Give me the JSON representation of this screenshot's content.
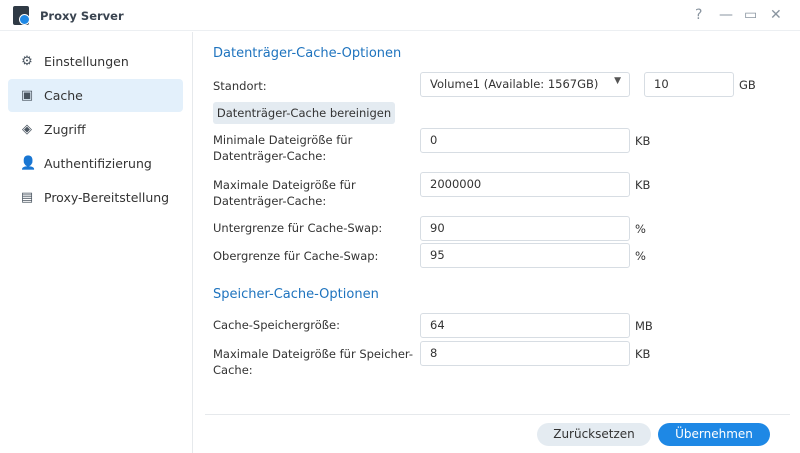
{
  "window": {
    "title": "Proxy Server",
    "help": "?",
    "minimize": "—",
    "maximize": "▭",
    "close": "✕"
  },
  "sidebar": {
    "items": [
      {
        "label": "Einstellungen",
        "icon": "gear-icon"
      },
      {
        "label": "Cache",
        "icon": "cache-icon"
      },
      {
        "label": "Zugriff",
        "icon": "shield-icon"
      },
      {
        "label": "Authentifizierung",
        "icon": "user-icon"
      },
      {
        "label": "Proxy-Bereitstellung",
        "icon": "router-icon"
      }
    ]
  },
  "disk": {
    "title": "Datenträger-Cache-Optionen",
    "location_label": "Standort:",
    "location_value": "Volume1 (Available: 1567GB)",
    "size_value": "10",
    "size_unit": "GB",
    "clear_button": "Datenträger-Cache bereinigen",
    "min_label": "Minimale Dateigröße für Datenträger-Cache:",
    "min_value": "0",
    "min_unit": "KB",
    "max_label": "Maximale Dateigröße für Datenträger-Cache:",
    "max_value": "2000000",
    "max_unit": "KB",
    "low_label": "Untergrenze für Cache-Swap:",
    "low_value": "90",
    "low_unit": "%",
    "high_label": "Obergrenze für Cache-Swap:",
    "high_value": "95",
    "high_unit": "%"
  },
  "memory": {
    "title": "Speicher-Cache-Optionen",
    "size_label": "Cache-Speichergröße:",
    "size_value": "64",
    "size_unit": "MB",
    "max_label": "Maximale Dateigröße für Speicher-Cache:",
    "max_value": "8",
    "max_unit": "KB"
  },
  "footer": {
    "reset": "Zurücksetzen",
    "apply": "Übernehmen"
  },
  "colors": {
    "accent": "#1e88e5",
    "active_bg": "#e3f0fb"
  }
}
